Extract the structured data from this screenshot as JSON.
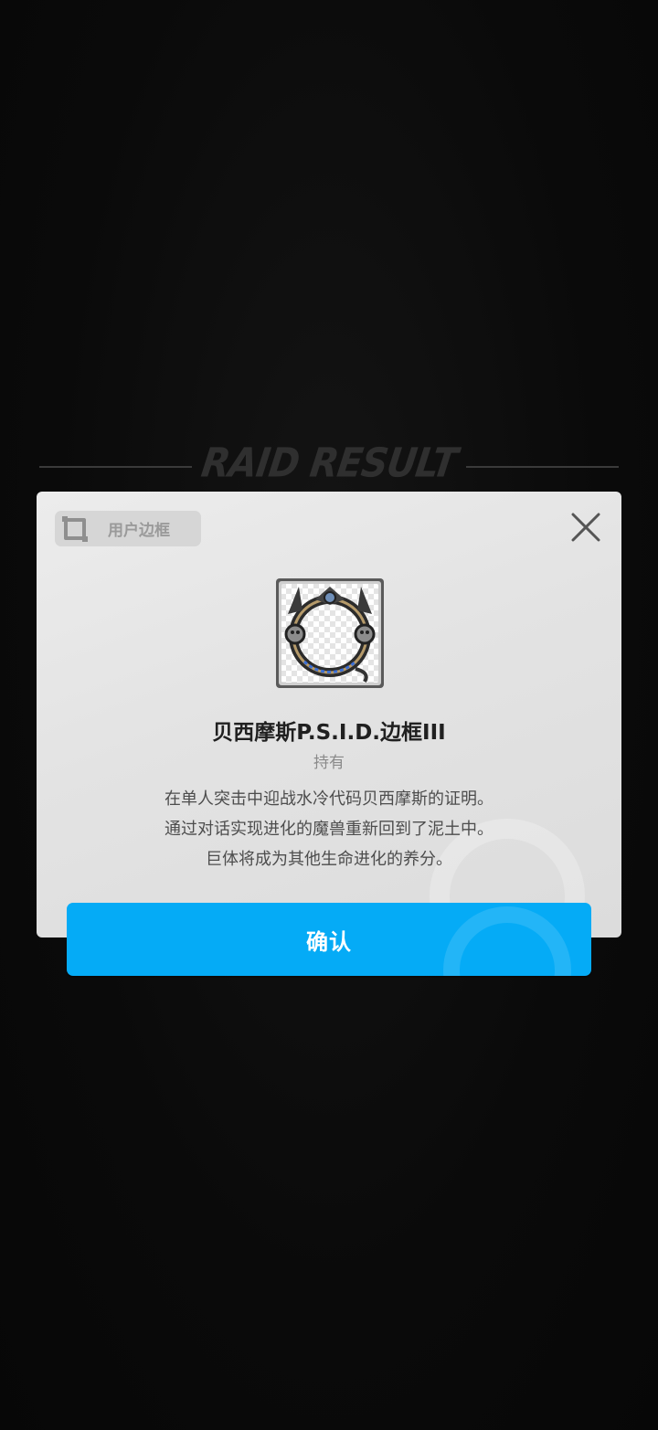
{
  "background": {
    "title": "RAID RESULT"
  },
  "dialog": {
    "badge_label": "用户边框",
    "item_name": "贝西摩斯P.S.I.D.边框III",
    "status": "持有",
    "description": [
      "在单人突击中迎战水冷代码贝西摩斯的证明。",
      "通过对话实现进化的魔兽重新回到了泥土中。",
      "巨体将成为其他生命进化的养分。"
    ],
    "confirm_label": "确认"
  },
  "colors": {
    "confirm_button": "#05abf6",
    "dialog_bg": "#e6e6e6"
  },
  "icons": {
    "close": "close-icon",
    "badge": "frame-icon",
    "item": "ornate-frame-icon"
  }
}
